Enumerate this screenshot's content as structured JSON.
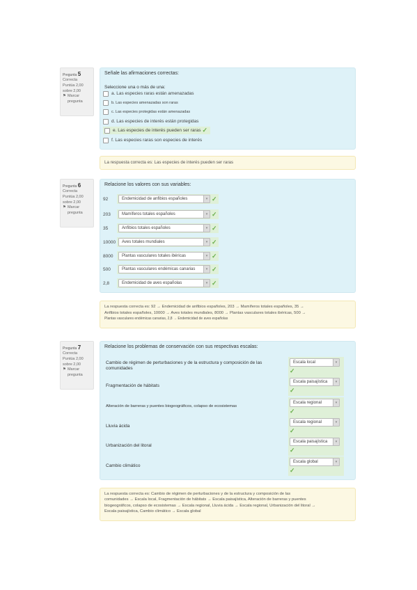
{
  "q5": {
    "info": {
      "label": "Pregunta",
      "number": "5",
      "status": "Correcta",
      "score": "Puntúa 2,00 sobre 2,00",
      "flag": "Marcar pregunta"
    },
    "prompt": "Señale las afirmaciones correctas:",
    "instruction": "Seleccione una o más de una:",
    "options": [
      {
        "text": "a. Las especies raras están amenazadas",
        "correct": false
      },
      {
        "text": "b. Las especies amenazadas son raras",
        "correct": false
      },
      {
        "text": "c. Las especies protegidas están amenazadas",
        "correct": false
      },
      {
        "text": "d. Las especies de interés están protegidas",
        "correct": false
      },
      {
        "text": "e. Las especies de interés pueden ser raras",
        "correct": true
      },
      {
        "text": "f. Las especies raras son especies de interés",
        "correct": false
      }
    ],
    "feedback": "La respuesta correcta es: Las especies de interés pueden ser raras"
  },
  "q6": {
    "info": {
      "label": "Pregunta",
      "number": "6",
      "status": "Correcta",
      "score": "Puntúa 2,00 sobre 2,00",
      "flag": "Marcar pregunta"
    },
    "prompt": "Relacione los valores con sus variables:",
    "rows": [
      {
        "value": "92",
        "answer": "Endemicidad de anfibios españoles"
      },
      {
        "value": "203",
        "answer": "Mamíferos totales españoles"
      },
      {
        "value": "35",
        "answer": "Anfibios totales españoles"
      },
      {
        "value": "10000",
        "answer": "Aves totales mundiales"
      },
      {
        "value": "8000",
        "answer": "Plantas vasculares totales ibéricas"
      },
      {
        "value": "500",
        "answer": "Plantas vasculares endémicas canarias"
      },
      {
        "value": "2,8",
        "answer": "Endemicidad de aves españolas"
      }
    ],
    "feedback_l1": "La respuesta correcta es: 92 → Endemicidad de anfibios españoles, 203 → Mamíferos totales españoles, 35 →",
    "feedback_l2": "Anfibios totales españoles, 10000 → Aves totales mundiales, 8000 → Plantas vasculares totales ibéricas, 500 →",
    "feedback_l3": "Plantas vasculares endémicas canarias, 2,8 → Endemicidad de aves españolas"
  },
  "q7": {
    "info": {
      "label": "Pregunta",
      "number": "7",
      "status": "Correcta",
      "score": "Puntúa 2,00 sobre 2,00",
      "flag": "Marcar pregunta"
    },
    "prompt": "Relacione los problemas de conservación con sus respectivas escalas:",
    "rows": [
      {
        "problem": "Cambio de régimen de perturbaciones y de la estructura y composición de las comunidades",
        "scale": "Escala local"
      },
      {
        "problem": "Fragmentación de hábitats",
        "scale": "Escala paisajística"
      },
      {
        "problem": "Alteración de barreras y puentes biogeográficos, colapso de ecosistemas",
        "scale": "Escala regional"
      },
      {
        "problem": "Lluvia ácida",
        "scale": "Escala regional"
      },
      {
        "problem": "Urbanización del litoral",
        "scale": "Escala paisajística"
      },
      {
        "problem": "Cambio climático",
        "scale": "Escala global"
      }
    ],
    "feedback_l1": "La respuesta correcta es: Cambio de régimen de perturbaciones y de la estructura y composición de las",
    "feedback_l2": "comunidades → Escala local, Fragmentación de hábitats → Escala paisajística, Alteración de barreras y puentes",
    "feedback_l3": "biogeográficos, colapso de ecosistemas → Escala regional, Lluvia ácida → Escala regional, Urbanización del litoral →",
    "feedback_l4": "Escala paisajística, Cambio climático → Escala global"
  },
  "colors": {
    "question_bg": "#def2f8",
    "feedback_bg": "#fcf8e3",
    "correct_bg": "#dff0d8",
    "tick": "#6ab04c"
  }
}
